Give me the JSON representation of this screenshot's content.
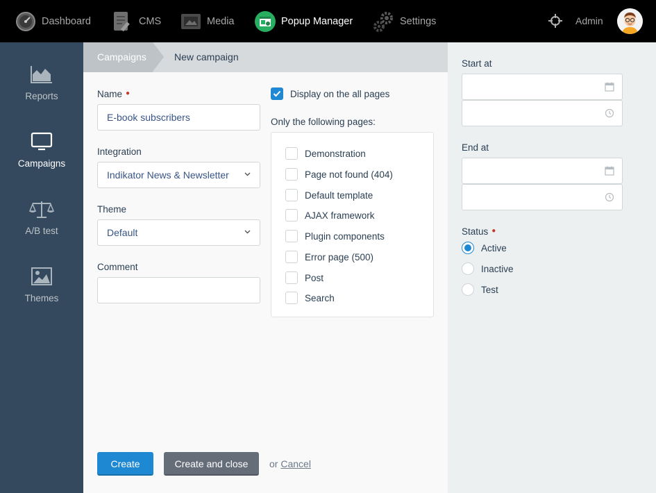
{
  "topnav": {
    "dashboard": "Dashboard",
    "cms": "CMS",
    "media": "Media",
    "popup_manager": "Popup Manager",
    "settings": "Settings",
    "admin": "Admin"
  },
  "sidebar": {
    "items": [
      {
        "label": "Reports",
        "icon": "area-chart-icon"
      },
      {
        "label": "Campaigns",
        "icon": "monitor-icon",
        "active": true
      },
      {
        "label": "A/B test",
        "icon": "balance-scale-icon"
      },
      {
        "label": "Themes",
        "icon": "image-icon"
      }
    ]
  },
  "breadcrumb": {
    "parent": "Campaigns",
    "current": "New campaign"
  },
  "form": {
    "name_label": "Name",
    "name_value": "E-book subscribers",
    "integration_label": "Integration",
    "integration_value": "Indikator News & Newsletter",
    "theme_label": "Theme",
    "theme_value": "Default",
    "comment_label": "Comment",
    "comment_value": "",
    "display_all_label": "Display on the all pages",
    "display_all_checked": true,
    "only_pages_label": "Only the following pages:",
    "pages": [
      "Demonstration",
      "Page not found (404)",
      "Default template",
      "AJAX framework",
      "Plugin components",
      "Error page (500)",
      "Post",
      "Search"
    ]
  },
  "buttons": {
    "create": "Create",
    "create_close": "Create and close",
    "or": "or",
    "cancel": "Cancel"
  },
  "schedule": {
    "start_label": "Start at",
    "end_label": "End at"
  },
  "status": {
    "label": "Status",
    "options": [
      "Active",
      "Inactive",
      "Test"
    ],
    "selected": "Active"
  },
  "colors": {
    "accent": "#1e88d3",
    "sidebar": "#34495e",
    "required": "#c0392b"
  }
}
